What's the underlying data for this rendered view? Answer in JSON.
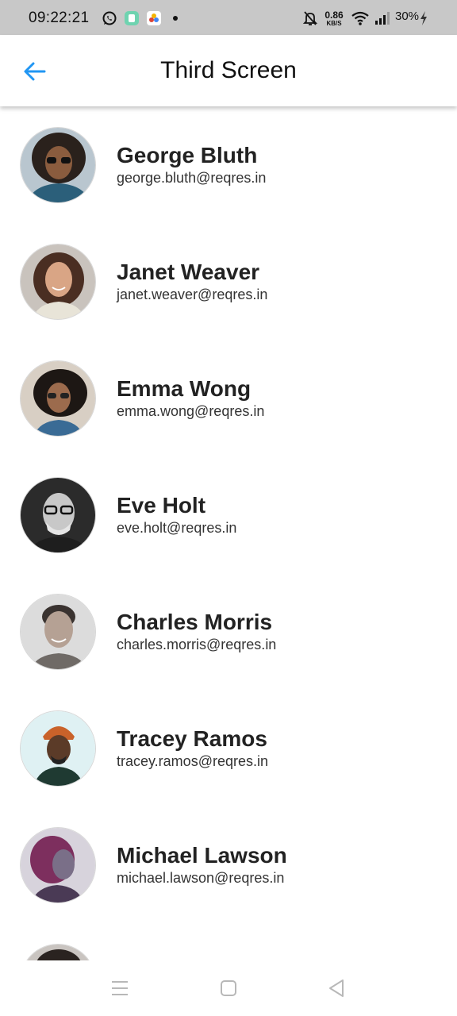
{
  "status_bar": {
    "time": "09:22:21",
    "network_speed_value": "0.86",
    "network_speed_unit": "KB/S",
    "battery": "30%",
    "icons": [
      "whatsapp-icon",
      "app-icon",
      "photos-icon",
      "notification-dot-icon",
      "bell-off-icon",
      "wifi-icon",
      "signal-icon",
      "charging-bolt-icon"
    ]
  },
  "app_bar": {
    "title": "Third Screen",
    "back_icon": "arrow-left-icon",
    "accent": "#2196F3"
  },
  "users": [
    {
      "name": "George Bluth",
      "email": "george.bluth@reqres.in"
    },
    {
      "name": "Janet Weaver",
      "email": "janet.weaver@reqres.in"
    },
    {
      "name": "Emma Wong",
      "email": "emma.wong@reqres.in"
    },
    {
      "name": "Eve Holt",
      "email": "eve.holt@reqres.in"
    },
    {
      "name": "Charles Morris",
      "email": "charles.morris@reqres.in"
    },
    {
      "name": "Tracey Ramos",
      "email": "tracey.ramos@reqres.in"
    },
    {
      "name": "Michael Lawson",
      "email": "michael.lawson@reqres.in"
    }
  ],
  "nav_bar": {
    "icons": [
      "menu-icon",
      "home-icon",
      "back-triangle-icon"
    ]
  }
}
